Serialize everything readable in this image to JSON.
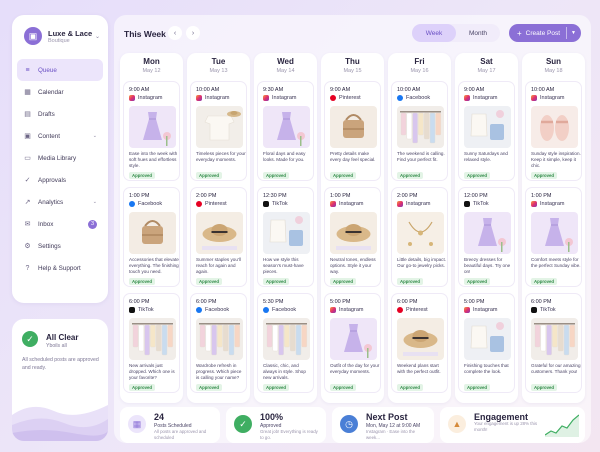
{
  "brand": {
    "name": "Luxe & Lace",
    "sub": "Boutique",
    "logo_icon": "shopping-bag-icon"
  },
  "nav": [
    {
      "label": "Queue",
      "icon": "queue-icon",
      "glyph": "≡",
      "active": true
    },
    {
      "label": "Calendar",
      "icon": "calendar-icon",
      "glyph": "▦"
    },
    {
      "label": "Drafts",
      "icon": "drafts-icon",
      "glyph": "▤"
    },
    {
      "label": "Content",
      "icon": "content-icon",
      "glyph": "▣",
      "chevron": true
    },
    {
      "label": "Media Library",
      "icon": "media-icon",
      "glyph": "▭"
    },
    {
      "label": "Approvals",
      "icon": "approvals-icon",
      "glyph": "✓"
    },
    {
      "label": "Analytics",
      "icon": "analytics-icon",
      "glyph": "↗",
      "chevron": true
    },
    {
      "label": "Inbox",
      "icon": "inbox-icon",
      "glyph": "✉",
      "badge": "3"
    },
    {
      "label": "Settings",
      "icon": "settings-icon",
      "glyph": "⚙"
    },
    {
      "label": "Help & Support",
      "icon": "help-icon",
      "glyph": "?"
    }
  ],
  "all_clear": {
    "title": "All Clear",
    "sub": "Yboils all",
    "desc": "All scheduled posts are approved and ready."
  },
  "header": {
    "title": "This Week",
    "prev": "‹",
    "next": "›",
    "views": [
      "Week",
      "Month"
    ],
    "active_view": "Week",
    "create": "Create Post"
  },
  "days": [
    {
      "name": "Mon",
      "date": "May 12",
      "posts": [
        {
          "time": "9:00 AM",
          "platform": "Instagram",
          "caption": "Ease into the week with soft hues and effortless style.",
          "status": "Approved",
          "image": "dress"
        },
        {
          "time": "1:00 PM",
          "platform": "Facebook",
          "caption": "Accessories that elevate everything. The finishing touch you need.",
          "status": "Approved",
          "image": "bag"
        },
        {
          "time": "6:00 PM",
          "platform": "TikTok",
          "caption": "New arrivals just dropped. Which one is your favorite?",
          "status": "Approved",
          "image": "rack"
        }
      ]
    },
    {
      "name": "Tue",
      "date": "May 13",
      "posts": [
        {
          "time": "10:00 AM",
          "platform": "Instagram",
          "caption": "Timeless pieces for your everyday moments.",
          "status": "Approved",
          "image": "knit"
        },
        {
          "time": "2:00 PM",
          "platform": "Pinterest",
          "caption": "Summer staples you'll reach for again and again.",
          "status": "Approved",
          "image": "hat"
        },
        {
          "time": "6:00 PM",
          "platform": "Facebook",
          "caption": "Wardrobe refresh in progress. Which piece is calling your name?",
          "status": "Approved",
          "image": "rack"
        }
      ]
    },
    {
      "name": "Wed",
      "date": "May 14",
      "posts": [
        {
          "time": "9:30 AM",
          "platform": "Instagram",
          "caption": "Floral days and easy looks. Made for you.",
          "status": "Approved",
          "image": "dress"
        },
        {
          "time": "12:30 PM",
          "platform": "TikTok",
          "caption": "How we style this season's must-have pieces.",
          "status": "Approved",
          "image": "outfit"
        },
        {
          "time": "5:30 PM",
          "platform": "Facebook",
          "caption": "Classic, chic, and always in style. Shop new arrivals.",
          "status": "Approved",
          "image": "rack"
        }
      ]
    },
    {
      "name": "Thu",
      "date": "May 15",
      "posts": [
        {
          "time": "9:00 AM",
          "platform": "Pinterest",
          "caption": "Pretty details make every day feel special.",
          "status": "Approved",
          "image": "bag"
        },
        {
          "time": "1:00 PM",
          "platform": "Instagram",
          "caption": "Neutral tones, endless options. Style it your way.",
          "status": "Approved",
          "image": "hat"
        },
        {
          "time": "5:00 PM",
          "platform": "Instagram",
          "caption": "Outfit of the day for your everyday moments.",
          "status": "Approved",
          "image": "dress"
        }
      ]
    },
    {
      "name": "Fri",
      "date": "May 16",
      "posts": [
        {
          "time": "10:00 AM",
          "platform": "Facebook",
          "caption": "The weekend is calling. Find your perfect fit.",
          "status": "Approved",
          "image": "rack"
        },
        {
          "time": "2:00 PM",
          "platform": "Instagram",
          "caption": "Little details, big impact. Our go-to jewelry picks.",
          "status": "Approved",
          "image": "jewelry"
        },
        {
          "time": "6:00 PM",
          "platform": "Pinterest",
          "caption": "Weekend plans start with the perfect outfit.",
          "status": "Approved",
          "image": "hat"
        }
      ]
    },
    {
      "name": "Sat",
      "date": "May 17",
      "posts": [
        {
          "time": "9:00 AM",
          "platform": "Instagram",
          "caption": "Sunny Saturdays and relaxed style.",
          "status": "Approved",
          "image": "outfit"
        },
        {
          "time": "12:00 PM",
          "platform": "TikTok",
          "caption": "Breezy dresses for beautiful days. Try one on!",
          "status": "Approved",
          "image": "dress"
        },
        {
          "time": "5:00 PM",
          "platform": "Instagram",
          "caption": "Finishing touches that complete the look.",
          "status": "Approved",
          "image": "outfit"
        }
      ]
    },
    {
      "name": "Sun",
      "date": "May 18",
      "posts": [
        {
          "time": "10:00 AM",
          "platform": "Instagram",
          "caption": "Sunday style inspiration. Keep it simple, keep it chic.",
          "status": "Approved",
          "image": "sandals"
        },
        {
          "time": "1:00 PM",
          "platform": "Instagram",
          "caption": "Comfort meets style for the perfect Sunday vibe.",
          "status": "Approved",
          "image": "dress"
        },
        {
          "time": "6:00 PM",
          "platform": "TikTok",
          "caption": "Grateful for our amazing customers. Thank you!",
          "status": "Approved",
          "image": "rack"
        }
      ]
    }
  ],
  "stats": [
    {
      "value": "24",
      "label": "Posts Scheduled",
      "desc": "All posts are approved and scheduled",
      "icon": "calendar-icon"
    },
    {
      "value": "100%",
      "label": "Approved",
      "desc": "Great job! Everything is ready to go.",
      "icon": "check-icon"
    },
    {
      "value": "Next Post",
      "label": "Mon, May 12 at 9:00 AM",
      "desc": "Instagram · Ease into the week...",
      "icon": "clock-icon"
    },
    {
      "value": "Engagement",
      "label": "",
      "desc": "Your engagement is up 28% this month!",
      "icon": "trend-icon"
    }
  ],
  "colors": {
    "accent": "#8b6fd6",
    "approved_bg": "#e3f4e6",
    "approved_text": "#2f8a47",
    "clear_green": "#3fae62"
  }
}
